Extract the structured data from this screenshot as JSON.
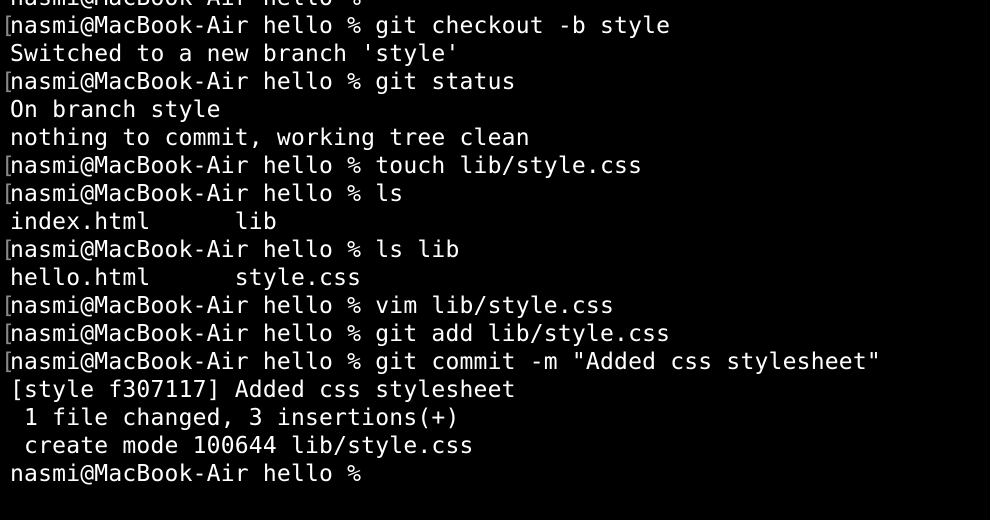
{
  "terminal": {
    "lines": [
      {
        "text": "nasmi@MacBook-Air hello %",
        "marker": ""
      },
      {
        "text": "nasmi@MacBook-Air hello % git checkout -b style",
        "marker": "["
      },
      {
        "text": "Switched to a new branch 'style'",
        "marker": ""
      },
      {
        "text": "nasmi@MacBook-Air hello % git status",
        "marker": "["
      },
      {
        "text": "On branch style",
        "marker": ""
      },
      {
        "text": "nothing to commit, working tree clean",
        "marker": ""
      },
      {
        "text": "nasmi@MacBook-Air hello % touch lib/style.css",
        "marker": "["
      },
      {
        "text": "nasmi@MacBook-Air hello % ls",
        "marker": "["
      },
      {
        "text": "index.html      lib",
        "marker": ""
      },
      {
        "text": "nasmi@MacBook-Air hello % ls lib",
        "marker": "["
      },
      {
        "text": "hello.html      style.css",
        "marker": ""
      },
      {
        "text": "nasmi@MacBook-Air hello % vim lib/style.css",
        "marker": "["
      },
      {
        "text": "nasmi@MacBook-Air hello % git add lib/style.css",
        "marker": "["
      },
      {
        "text": "nasmi@MacBook-Air hello % git commit -m \"Added css stylesheet\"",
        "marker": "["
      },
      {
        "text": "[style f307117] Added css stylesheet",
        "marker": ""
      },
      {
        "text": " 1 file changed, 3 insertions(+)",
        "marker": ""
      },
      {
        "text": " create mode 100644 lib/style.css",
        "marker": ""
      },
      {
        "text": "nasmi@MacBook-Air hello %",
        "marker": ""
      }
    ]
  }
}
